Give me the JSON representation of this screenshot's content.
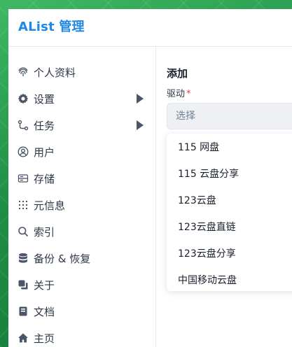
{
  "app": {
    "brand": "AList 管理"
  },
  "sidebar": {
    "items": [
      {
        "label": "个人资料",
        "icon": "fingerprint-icon"
      },
      {
        "label": "设置",
        "icon": "gear-icon"
      },
      {
        "label": "任务",
        "icon": "route-icon"
      },
      {
        "label": "用户",
        "icon": "user-circle-icon"
      },
      {
        "label": "存储",
        "icon": "storage-icon"
      },
      {
        "label": "元信息",
        "icon": "metadata-icon"
      },
      {
        "label": "索引",
        "icon": "search-icon"
      },
      {
        "label": "备份 & 恢复",
        "icon": "database-icon"
      },
      {
        "label": "关于",
        "icon": "about-icon"
      },
      {
        "label": "文档",
        "icon": "book-icon"
      },
      {
        "label": "主页",
        "icon": "home-icon"
      }
    ]
  },
  "main": {
    "section_title": "添加",
    "driver_field": {
      "label": "驱动",
      "required_mark": "*",
      "placeholder": "选择",
      "options": [
        "115 网盘",
        "115 云盘分享",
        "123云盘",
        "123云盘直链",
        "123云盘分享",
        "中国移动云盘"
      ]
    }
  },
  "colors": {
    "brand": "#1e88e5",
    "required": "#e53e3e",
    "background": "#1f8e45"
  }
}
